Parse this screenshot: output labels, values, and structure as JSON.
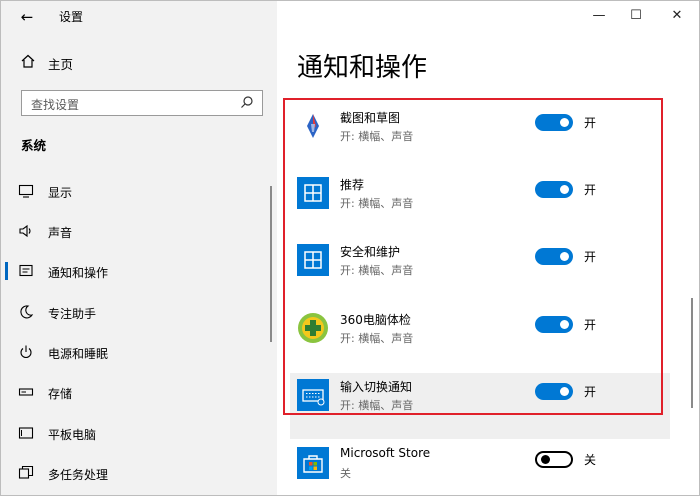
{
  "window": {
    "title": "设置",
    "controls": {
      "minimize": "—",
      "maximize": "☐",
      "close": "✕"
    }
  },
  "sidebar": {
    "back_label": "←",
    "home_label": "主页",
    "search_placeholder": "查找设置",
    "section_label": "系统",
    "items": [
      {
        "label": "显示",
        "icon": "monitor-icon",
        "active": false
      },
      {
        "label": "声音",
        "icon": "speaker-icon",
        "active": false
      },
      {
        "label": "通知和操作",
        "icon": "notification-icon",
        "active": true
      },
      {
        "label": "专注助手",
        "icon": "moon-icon",
        "active": false
      },
      {
        "label": "电源和睡眠",
        "icon": "power-icon",
        "active": false
      },
      {
        "label": "存储",
        "icon": "storage-icon",
        "active": false
      },
      {
        "label": "平板电脑",
        "icon": "tablet-icon",
        "active": false
      },
      {
        "label": "多任务处理",
        "icon": "multitask-icon",
        "active": false
      }
    ]
  },
  "main": {
    "page_title": "通知和操作",
    "apps": [
      {
        "name": "截图和草图",
        "detail": "开: 横幅、声音",
        "state": "开",
        "on": true,
        "icon": "snip-sketch-icon"
      },
      {
        "name": "推荐",
        "detail": "开: 横幅、声音",
        "state": "开",
        "on": true,
        "icon": "suggested-icon"
      },
      {
        "name": "安全和维护",
        "detail": "开: 横幅、声音",
        "state": "开",
        "on": true,
        "icon": "security-maintenance-icon"
      },
      {
        "name": "360电脑体检",
        "detail": "开: 横幅、声音",
        "state": "开",
        "on": true,
        "icon": "360-checkup-icon"
      },
      {
        "name": "输入切换通知",
        "detail": "开: 横幅、声音",
        "state": "开",
        "on": true,
        "icon": "keyboard-icon"
      },
      {
        "name": "Microsoft Store",
        "detail": "关",
        "state": "关",
        "on": false,
        "icon": "store-icon"
      }
    ]
  },
  "colors": {
    "accent": "#0078d4",
    "highlight": "#e0202a",
    "sidebar_bg": "#f2f2f2"
  }
}
